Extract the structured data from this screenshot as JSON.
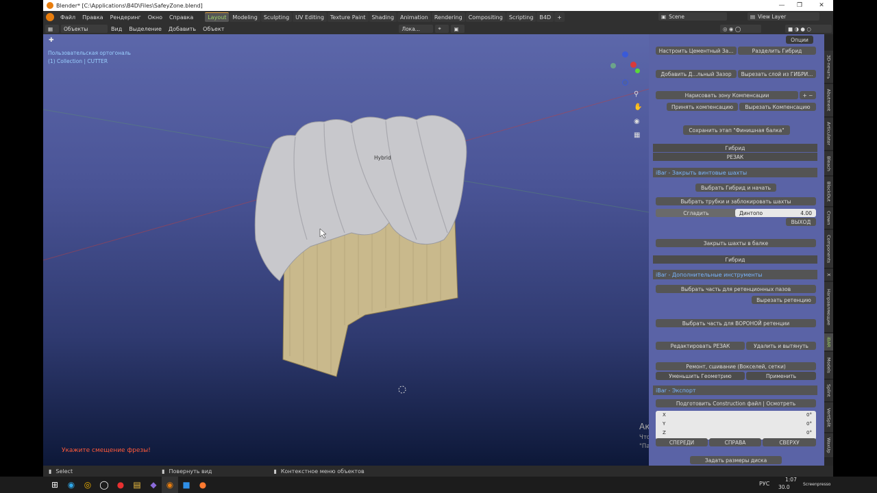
{
  "window": {
    "title": "Blender* [C:\\Applications\\B4D\\Files\\SafeyZone.blend]"
  },
  "menu": [
    "Файл",
    "Правка",
    "Рендеринг",
    "Окно",
    "Справка"
  ],
  "workspaces": [
    {
      "label": "Layout",
      "active": true
    },
    {
      "label": "Modeling"
    },
    {
      "label": "Sculpting"
    },
    {
      "label": "UV Editing"
    },
    {
      "label": "Texture Paint"
    },
    {
      "label": "Shading"
    },
    {
      "label": "Animation"
    },
    {
      "label": "Rendering"
    },
    {
      "label": "Compositing"
    },
    {
      "label": "Scripting"
    },
    {
      "label": "B4D"
    }
  ],
  "scene": {
    "name": "Scene",
    "view_layer": "View Layer"
  },
  "header": {
    "mode": "Объекты",
    "view": "Вид",
    "select": "Выделение",
    "add": "Добавить",
    "object": "Объект",
    "orient": "Лока...",
    "options": "Опции"
  },
  "viewport": {
    "overlay_line1": "Пользовательская ортогональ",
    "overlay_line2": "(1) Collection | CUTTER",
    "object_label": "Hybrid",
    "prompt": "Укажите смещение фрезы!",
    "watermark_title": "Активация Windows",
    "watermark_body1": "Чтобы активировать Windows, перейдите в раздел",
    "watermark_body2": "\"Параметры\"."
  },
  "panel": {
    "row1_left": "Настроить Цементный За...",
    "row1_right": "Разделить Гибрид",
    "row2_left": "Добавить Д...льный Зазор",
    "row2_right": "Вырезать слой из ГИБРИ...",
    "paint_comp": "Нарисовать зону Компенсации",
    "accept_comp": "Принять компенсацию",
    "cut_comp": "Вырезать Компенсацию",
    "save_stage": "Сохранить этап \"Финишная балка\"",
    "list1": "Гибрид",
    "list2": "РЕЗАК",
    "section1": "iBar - Закрыть винтовые шахты",
    "select_hybrid": "Выбрать Гибрид и начать",
    "select_tubes": "Выбрать трубки и заблокировать шахты",
    "smooth": "Сгладить",
    "dintopo": "Динтопо",
    "dintopo_val": "4.00",
    "exit": "ВЫХОД",
    "close_shafts": "Закрыть шахты в балке",
    "hybrid2": "Гибрид",
    "section2": "iBar - Дополнительные инструменты",
    "select_retention": "Выбрать часть для ретенционных пазов",
    "cut_retention": "Вырезать ретенцию",
    "select_funnel": "Выбрать часть для ВОРОНОЙ ретенции",
    "edit_cutter": "Редактировать РЕЗАК",
    "delete_extrude": "Удалить и вытянуть",
    "repair": "Ремонт, сшивание (Вокселей, сетки)",
    "reduce_geo": "Уменьшить Геометрию",
    "apply": "Применить",
    "section3": "iBar - Экспорт",
    "prepare_export": "Подготовить Construction файл | Осмотреть",
    "x_label": "X",
    "x_val": "0°",
    "y_label": "Y",
    "y_val": "0°",
    "z_label": "Z",
    "z_val": "0°",
    "front": "СПЕРЕДИ",
    "right": "СПРАВА",
    "top": "СВЕРХУ",
    "disk_size": "Задать размеры диска"
  },
  "ntabs": [
    "3D-печать",
    "Abutment",
    "Articulator",
    "Bleach",
    "BlockOut",
    "Crown",
    "Components",
    "X",
    "Направляющие",
    "iBAR",
    "Models",
    "Splint",
    "VertSplit",
    "WaxUp"
  ],
  "status": {
    "select": "Select",
    "rotate": "Повернуть вид",
    "context": "Контекстное меню объектов"
  },
  "taskbar": {
    "lang": "РУС",
    "time": "1:07",
    "date": "30.0",
    "brand": "Screenpresso"
  },
  "colors": {
    "accent": "#e87d0d",
    "panel_bg": "#5a63a6",
    "active_tab": "#9fd06a"
  }
}
